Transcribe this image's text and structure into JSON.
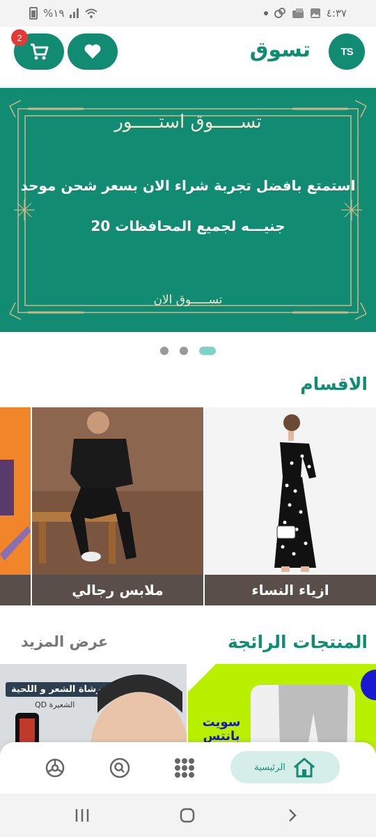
{
  "status_bar": {
    "battery_text": "%١٩",
    "time": "٤:٣٧"
  },
  "header": {
    "title": "تسوق",
    "logo_text": "TS",
    "cart_count": "2"
  },
  "banner": {
    "brand": "تســـــوق استـــــور",
    "line1": "استمتع بافضل تجربة شراء الان بسعر شحن موحد",
    "line2": "20 جنيـــه لجميع المحافظات",
    "cta": "تســـــوق الان",
    "bg_color": "#118c72",
    "pager": {
      "count": 3,
      "active_index": 2
    }
  },
  "categories": {
    "title": "الاقسام",
    "items": [
      {
        "label": "ازياء النساء"
      },
      {
        "label": "ملابس رجالي"
      },
      {
        "label": ""
      }
    ]
  },
  "trending": {
    "title": "المنتجات الرائجة",
    "more_label": "عرض المزيد",
    "cards": [
      {
        "headline": "فرشاة الشعر و اللحية",
        "brand": "QD الشعيرة"
      },
      {
        "headline": "سويت بانتس"
      }
    ]
  },
  "bottom_nav": {
    "home_label": "الرئيسية",
    "items": [
      "home-icon",
      "grid-icon",
      "search-icon",
      "settings-icon"
    ]
  },
  "colors": {
    "accent": "#118c72",
    "badge": "#e53935",
    "label_bg": "#5a4e4a"
  }
}
